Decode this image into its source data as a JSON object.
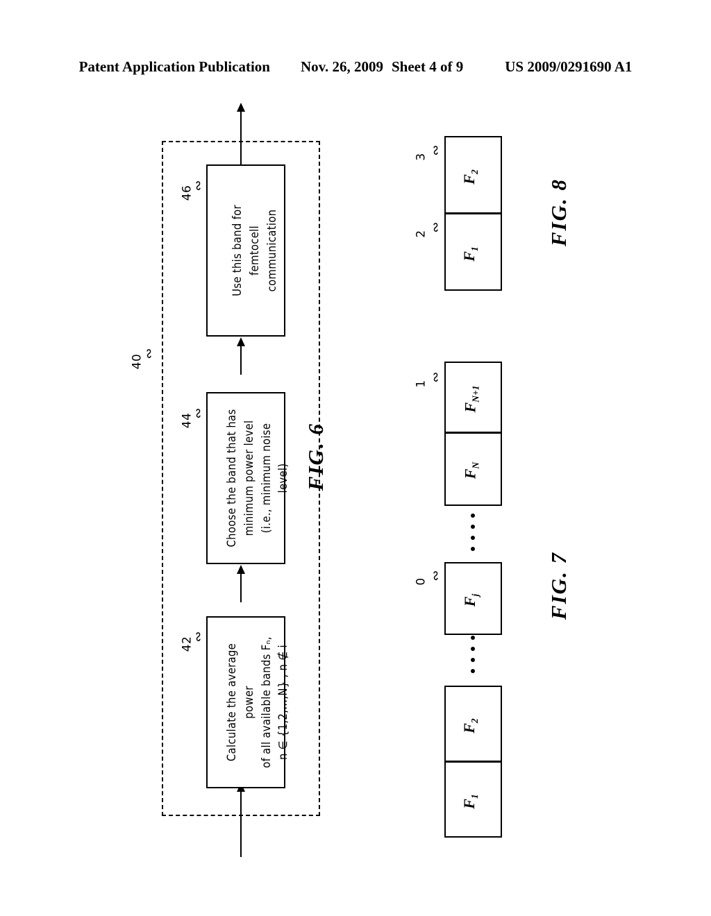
{
  "header": {
    "publication": "Patent Application Publication",
    "date": "Nov. 26, 2009",
    "sheet": "Sheet 4 of 9",
    "patent_number": "US 2009/0291690 A1"
  },
  "figures": [
    {
      "caption": "FIG. 6",
      "type": "flowchart",
      "boundary_ref": "40",
      "steps": [
        {
          "ref": "42",
          "lines": [
            "Calculate the average power",
            "of all available bands Fₙ,",
            "n ∈ {1,2,...,N} , n ∉ i"
          ]
        },
        {
          "ref": "44",
          "lines": [
            "Choose the band that has",
            "minimum power level",
            "(i.e., minimum noise level)"
          ]
        },
        {
          "ref": "46",
          "lines": [
            "Use this band for",
            "femtocell communication"
          ]
        }
      ]
    },
    {
      "caption": "FIG. 7",
      "type": "band-diagram",
      "cells": [
        {
          "label_base": "F",
          "label_sub": "1",
          "ref": ""
        },
        {
          "label_base": "F",
          "label_sub": "2",
          "ref": ""
        },
        {
          "label_base": "F",
          "label_sub": "j",
          "ref": "0"
        },
        {
          "label_base": "F",
          "label_sub": "N",
          "ref": ""
        },
        {
          "label_base": "F",
          "label_sub": "N+1",
          "ref": "1"
        }
      ],
      "ellipses": 2
    },
    {
      "caption": "FIG. 8",
      "type": "band-diagram",
      "cells": [
        {
          "label_base": "F",
          "label_sub": "1",
          "ref": "2"
        },
        {
          "label_base": "F",
          "label_sub": "2",
          "ref": "3"
        }
      ],
      "ellipses": 0
    }
  ]
}
